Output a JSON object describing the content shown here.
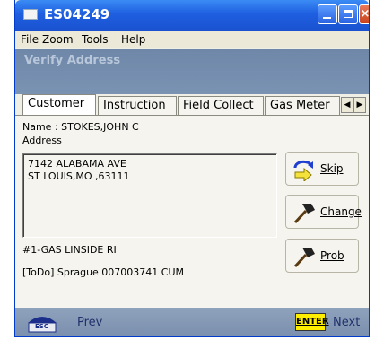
{
  "window": {
    "title": "ES04249"
  },
  "menu": [
    "File",
    "Zoom",
    "Tools",
    "Help"
  ],
  "header": {
    "title": "Verify Address"
  },
  "tabs": [
    "Customer",
    "Instruction",
    "Field Collect",
    "Gas Meter"
  ],
  "customer": {
    "name": "Name : STOKES,JOHN C",
    "address_label": "Address",
    "address_lines": [
      "7142 ALABAMA AVE",
      "ST LOUIS,MO ,63111"
    ],
    "service": "#1-GAS LINSIDE RI",
    "todo": "[ToDo] Sprague 007003741 CUM"
  },
  "actions": {
    "skip": "Skip",
    "change": "Change",
    "prob": "Prob"
  },
  "footer": {
    "esc": "ESC",
    "prev": "Prev",
    "enter": "ENTER",
    "next": "Next"
  },
  "colors": {
    "titlebar": "#1e5fe0",
    "header": "#7489aa",
    "enter_key": "#ffee00"
  }
}
